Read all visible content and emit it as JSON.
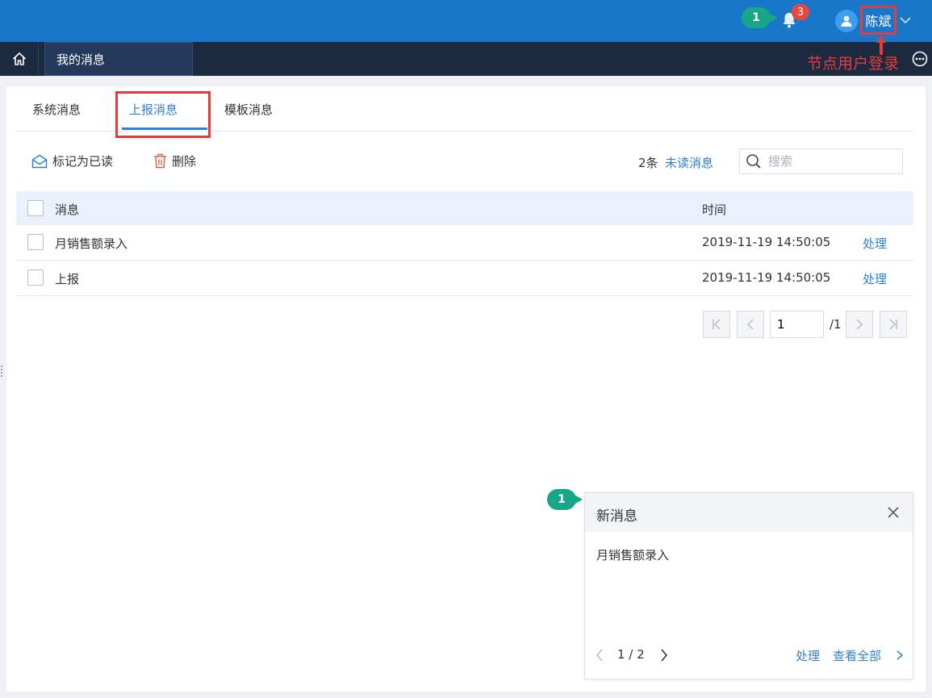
{
  "header": {
    "annotation_number": "1",
    "notification_count": "3",
    "username": "陈斌"
  },
  "nav": {
    "active_tab": "我的消息",
    "node_login_note": "节点用户登录"
  },
  "tabs": [
    {
      "label": "系统消息"
    },
    {
      "label": "上报消息"
    },
    {
      "label": "模板消息"
    }
  ],
  "toolbar": {
    "mark_read": "标记为已读",
    "delete": "删除",
    "count": "2条",
    "unread_link": "未读消息",
    "search_placeholder": "搜索"
  },
  "table": {
    "col_message": "消息",
    "col_time": "时间",
    "rows": [
      {
        "message": "月销售额录入",
        "time": "2019-11-19 14:50:05",
        "action": "处理"
      },
      {
        "message": "上报",
        "time": "2019-11-19 14:50:05",
        "action": "处理"
      }
    ]
  },
  "pager": {
    "current": "1",
    "total": "/1"
  },
  "popup": {
    "annotation_number": "1",
    "title": "新消息",
    "body": "月销售额录入",
    "page": "1 / 2",
    "handle": "处理",
    "view_all": "查看全部"
  },
  "colors": {
    "topbar": "#1877c9",
    "navbar": "#1c2a40",
    "accent": "#2f7fd6",
    "highlight": "#e53b3b",
    "annotation": "#17a688"
  }
}
